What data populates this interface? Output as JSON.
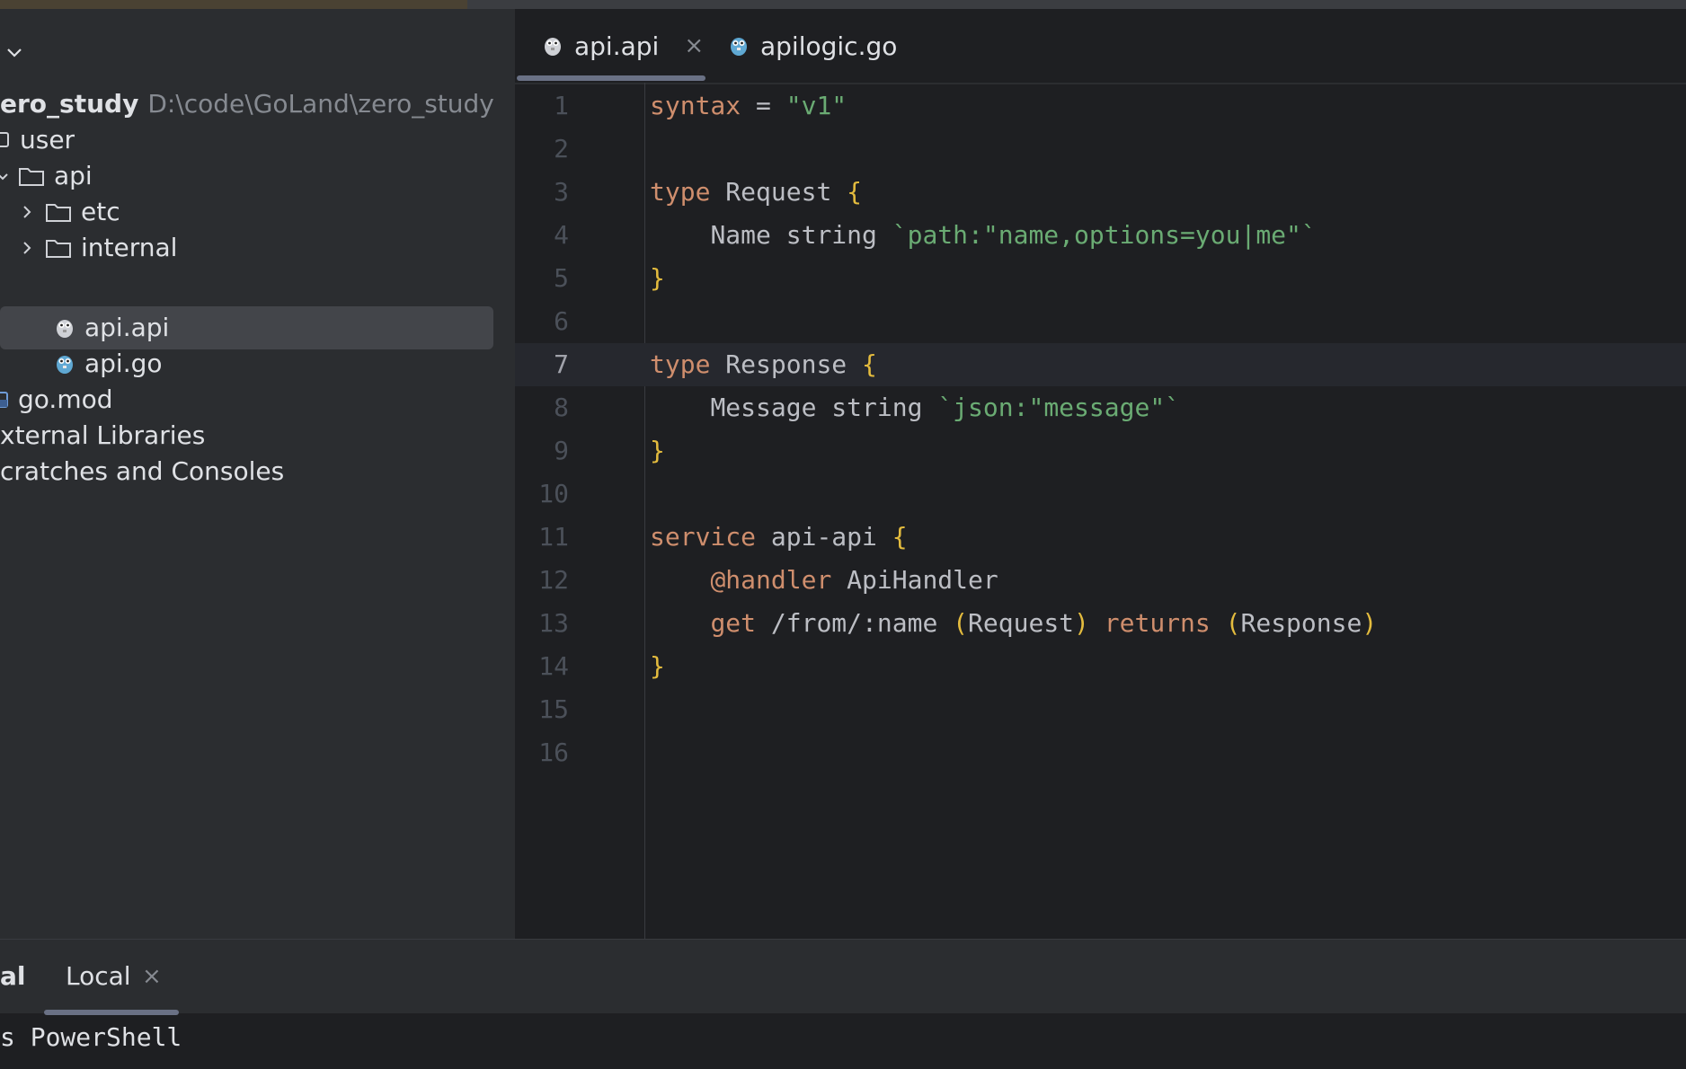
{
  "sidebar": {
    "project_name": "ero_study",
    "project_path": "D:\\code\\GoLand\\zero_study",
    "items": [
      {
        "label": "user"
      },
      {
        "label": "api"
      },
      {
        "label": "etc"
      },
      {
        "label": "internal"
      },
      {
        "label": "api.api"
      },
      {
        "label": "api.go"
      },
      {
        "label": "go.mod"
      },
      {
        "label": "xternal Libraries"
      },
      {
        "label": "cratches and Consoles"
      }
    ]
  },
  "editor": {
    "tabs": [
      {
        "label": "api.api",
        "icon": "gopher-api-icon",
        "active": true
      },
      {
        "label": "apilogic.go",
        "icon": "gopher-go-icon",
        "active": false
      }
    ],
    "current_line": 7,
    "lines": [
      {
        "n": "1"
      },
      {
        "n": "2"
      },
      {
        "n": "3"
      },
      {
        "n": "4"
      },
      {
        "n": "5"
      },
      {
        "n": "6"
      },
      {
        "n": "7"
      },
      {
        "n": "8"
      },
      {
        "n": "9"
      },
      {
        "n": "10"
      },
      {
        "n": "11"
      },
      {
        "n": "12"
      },
      {
        "n": "13"
      },
      {
        "n": "14"
      },
      {
        "n": "15"
      },
      {
        "n": "16"
      }
    ],
    "tokens": {
      "syntax": "syntax",
      "eq": " = ",
      "v1": "\"v1\"",
      "type": "type",
      "request": " Request ",
      "lbrace": "{",
      "rbrace": "}",
      "indent": "    ",
      "name_string": "Name string ",
      "name_tag": "`path:\"name,options=you|me\"`",
      "response": " Response ",
      "message_string": "Message string ",
      "message_tag": "`json:\"message\"`",
      "service": "service",
      "api_api": " api-api ",
      "handler": "@handler",
      "handler_name": " ApiHandler",
      "get": "get",
      "path": " /from/:name ",
      "lparen": "(",
      "rparen": ")",
      "request_type": "Request",
      "returns": " returns ",
      "response_type": "Response"
    }
  },
  "terminal": {
    "title": "al",
    "tab_label": "Local",
    "close": "×",
    "output": "s PowerShell"
  },
  "icons": {
    "tab_close": "×"
  },
  "colors": {
    "keyword": "#cf8e6d",
    "string": "#6aab73",
    "brace": "#e3bb3e",
    "text": "#bcbec4",
    "selection": "#43454a"
  }
}
